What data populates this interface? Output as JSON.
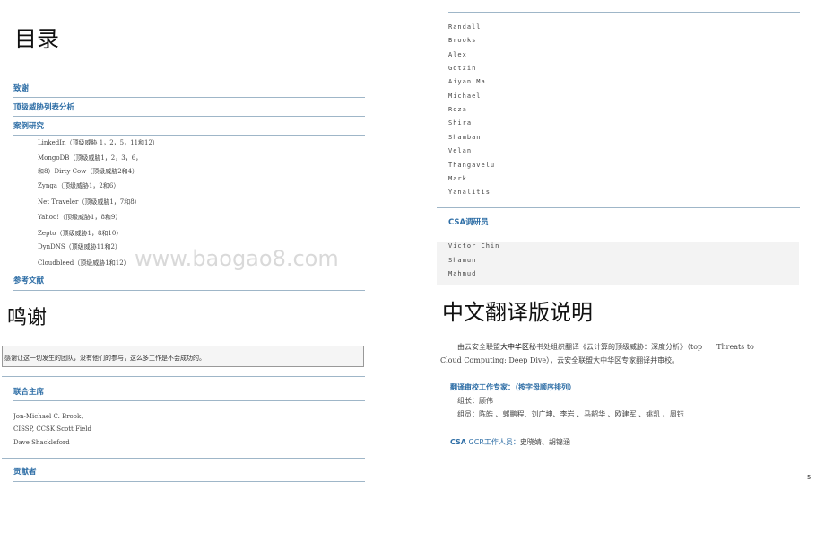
{
  "toc": {
    "title": "目录",
    "sections": {
      "acknowledgements": "致谢",
      "top_threats": "顶级威胁列表分析",
      "case_studies": "案例研究",
      "references": "参考文献"
    },
    "cases": [
      "LinkedIn（顶级威胁 1，2，5，11和12）",
      "MongoDB（顶级威胁1，2，3，6，",
      "和8）Dirty Cow（顶级威胁2和4）",
      "Zynga（顶级威胁1，2和6）",
      "Net Traveler（顶级威胁1，7和8）",
      "Yahoo!（顶级威胁1，8和9）",
      "Zepto（顶级威胁1，8和10）",
      "DynDNS（顶级威胁11和2）",
      "Cloudbleed（顶级威胁1和12）"
    ]
  },
  "watermark": "www.baogao8.com",
  "acknowledgements": {
    "title": "鸣谢",
    "thanks_text": "感谢让这一切发生的团队，没有他们的参与，这么多工作是不会成功的。",
    "co_chairs_heading": "联合主席",
    "co_chairs": [
      "Jon-Michael C. Brook，",
      "CISSP, CCSK Scott Field",
      "Dave Shackleford"
    ],
    "contributors_heading": "贡献者"
  },
  "right": {
    "contributors": [
      "Randall",
      "Brooks",
      "Alex",
      "Gotzin",
      "Aiyan Ma",
      "Michael",
      "Roza",
      "Shira",
      "Shamban",
      "Velan",
      "Thangavelu",
      "Mark",
      "Yanalitis"
    ],
    "csa_research_heading": "CSA调研员",
    "csa_researchers": [
      "Victor Chin",
      "Shamun",
      "Mahmud"
    ],
    "cn_title": "中文翻译版说明",
    "intro_line1_pre": "由云安全联盟",
    "intro_line1_bold": "大中华区",
    "intro_line1_post": "秘书处组织翻译《云计算的顶级威胁：深度分析》（top　　Threats to",
    "intro_line2": "Cloud Computing: Deep Dive），云安全联盟大中华区专家翻译并审校。",
    "review_heading": "翻译审校工作专家：（按字母顺序排列）",
    "leader": "组长：顾伟",
    "members": "组员：陈皓 、郭鹏程、刘广坤、李岩 、马韶华 、欧建军 、姚凯 、周钰",
    "gcr_label_bold": "CSA",
    "gcr_label_light": "GCR工作人员：",
    "gcr_names": "史晓婧、胡锦涵"
  },
  "page_number": "5"
}
